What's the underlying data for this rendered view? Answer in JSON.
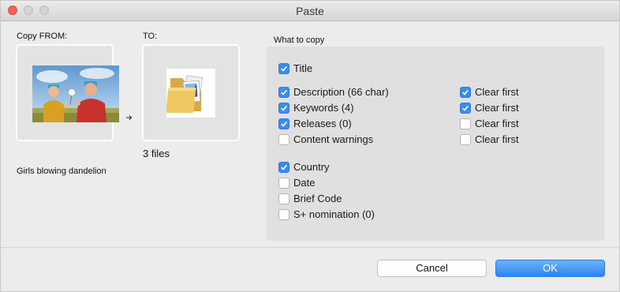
{
  "window": {
    "title": "Paste"
  },
  "from": {
    "label": "Copy FROM:",
    "caption": "Girls blowing dandelion"
  },
  "to": {
    "label": "TO:",
    "files_text": "3 files"
  },
  "what_to_copy": {
    "label": "What to copy",
    "options": [
      {
        "label": "Title",
        "checked": true
      },
      {
        "label": "Description (66 char)",
        "checked": true
      },
      {
        "label": "Keywords (4)",
        "checked": true
      },
      {
        "label": "Releases (0)",
        "checked": true
      },
      {
        "label": "Content warnings",
        "checked": false
      },
      {
        "label": "Country",
        "checked": true
      },
      {
        "label": "Date",
        "checked": false
      },
      {
        "label": "Brief Code",
        "checked": false
      },
      {
        "label": "S+ nomination (0)",
        "checked": false
      }
    ],
    "clear_first": [
      {
        "label": "Clear first",
        "checked": true
      },
      {
        "label": "Clear first",
        "checked": true
      },
      {
        "label": "Clear first",
        "checked": false
      },
      {
        "label": "Clear first",
        "checked": false
      }
    ]
  },
  "buttons": {
    "cancel": "Cancel",
    "ok": "OK"
  },
  "colors": {
    "accent": "#3a8cf2",
    "close": "#fc605c"
  },
  "icons": {
    "arrow": "arrow-right-icon",
    "folder": "folder-icon"
  }
}
